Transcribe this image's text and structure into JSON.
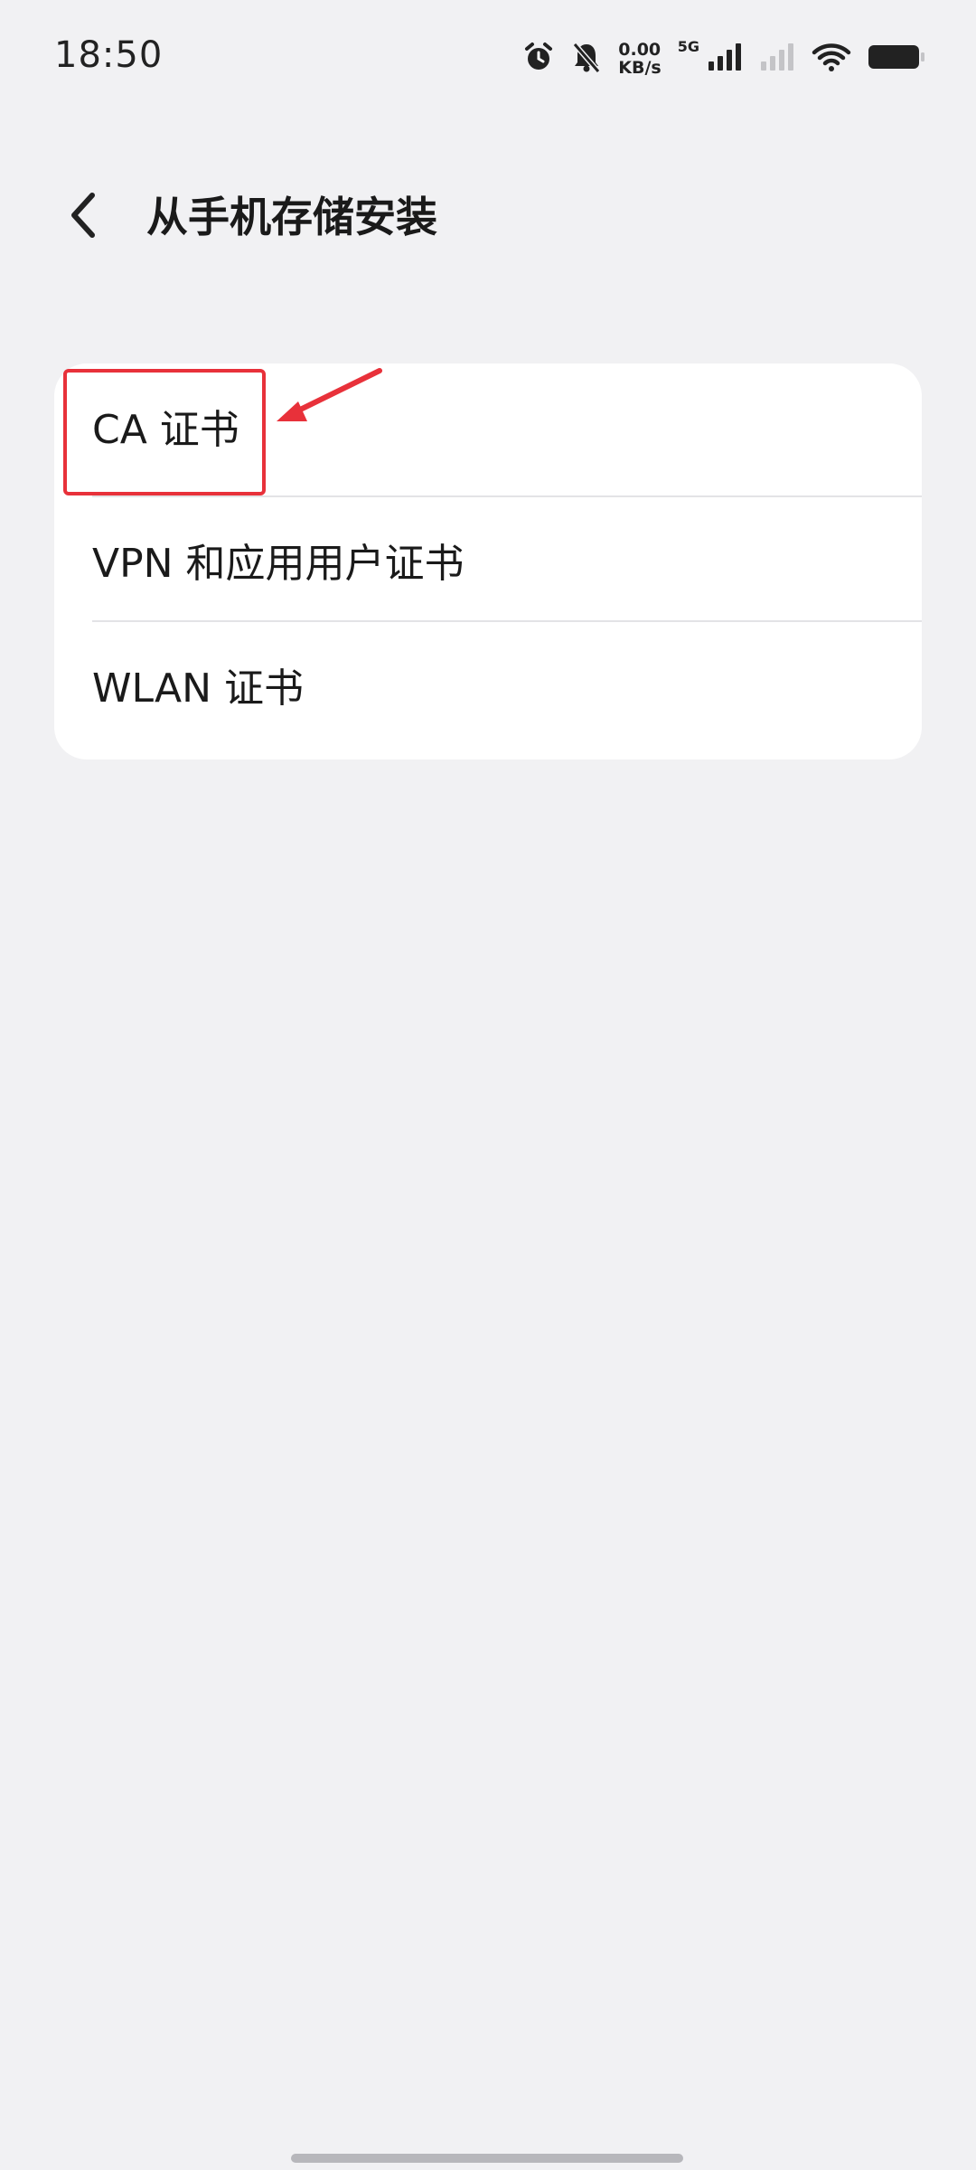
{
  "status_bar": {
    "time": "18:50",
    "speed_value": "0.00",
    "speed_unit": "KB/s",
    "network_type": "5G",
    "icons": [
      "alarm-icon",
      "bell-off-icon",
      "signal-icon",
      "signal-weak-icon",
      "wifi-icon",
      "battery-icon"
    ]
  },
  "header": {
    "back_icon": "chevron-left-icon",
    "title": "从手机存储安装"
  },
  "list": {
    "items": [
      {
        "label": "CA 证书"
      },
      {
        "label": "VPN 和应用用户证书"
      },
      {
        "label": "WLAN 证书"
      }
    ]
  },
  "annotation": {
    "color": "#e8313a"
  }
}
